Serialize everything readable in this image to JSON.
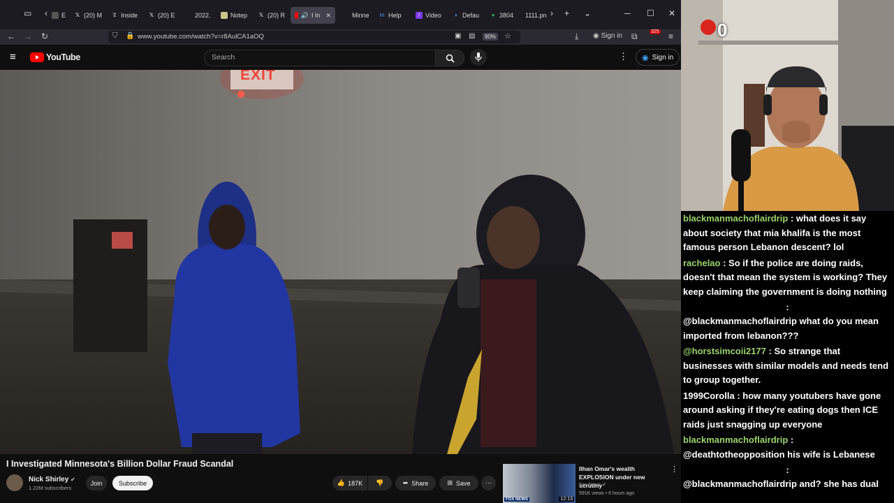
{
  "browser": {
    "tabs": [
      {
        "label": "E",
        "icon": "page-icon",
        "prefix": ")"
      },
      {
        "label": "(20) M",
        "icon": "x-icon"
      },
      {
        "label": "Inside",
        "icon": "nyt-icon"
      },
      {
        "label": "(20) E",
        "icon": "x-icon"
      },
      {
        "label": "2022.",
        "icon": "page-icon"
      },
      {
        "label": "Notep",
        "icon": "note-icon"
      },
      {
        "label": "(20) R",
        "icon": "x-icon"
      },
      {
        "label": "I In",
        "icon": "youtube-icon"
      },
      {
        "label": "Minne",
        "icon": "page-icon"
      },
      {
        "label": "Help",
        "icon": "m-icon"
      },
      {
        "label": "Video",
        "icon": "video-icon"
      },
      {
        "label": "Defau",
        "icon": "page-icon"
      },
      {
        "label": "3804",
        "icon": "map-icon"
      },
      {
        "label": "1111.pn",
        "icon": "page-icon"
      }
    ],
    "url": "www.youtube.com/watch?v=r8AulCA1aOQ",
    "zoom": "90%",
    "sign_in": "Sign in",
    "extensions_badge": "325"
  },
  "youtube": {
    "logo_text": "YouTube",
    "search_placeholder": "Search",
    "sign_in": "Sign in",
    "video_title": "I Investigated Minnesota's Billion Dollar Fraud Scandal",
    "channel_name": "Nick Shirley",
    "subscribers": "1.22M subscribers",
    "join_label": "Join",
    "subscribe_label": "Subscribe",
    "likes": "187K",
    "share_label": "Share",
    "save_label": "Save",
    "exit_sign": "EXIT",
    "recommended": {
      "title": "Ilhan Omar's wealth EXPLOSION under new scrutiny",
      "channel": "Fox News",
      "meta": "591K views • 6 hours ago",
      "duration": "12:13",
      "thumb_label": "FOX NEWS"
    }
  },
  "overlay": {
    "counter": "0"
  },
  "chat": [
    {
      "user": "blackmanmachoflairdrip",
      "text": ": what does it say about society that mia khalifa is the most famous person Lebanon descent? lol"
    },
    {
      "user": "rachelao",
      "text": ": So if the police are doing raids, doesn't that mean the system is working? They keep claiming the government is doing nothing"
    },
    {
      "sep": ":"
    },
    {
      "user": "",
      "text": "@blackmanmachoflairdrip what do you mean imported from lebanon???"
    },
    {
      "user": "@horstsimcoii2177",
      "text": ": So strange that businesses with similar models and needs tend to group together."
    },
    {
      "user": "1999Corolla",
      "text": ": how many youtubers have gone around asking if they're eating dogs then ICE raids just snagging up everyone",
      "white_user": true
    },
    {
      "user": "blackmanmachoflairdrip",
      "text": ":"
    },
    {
      "user": "",
      "text": "@deathtotheopposition his wife is Lebanese"
    },
    {
      "sep": ":"
    },
    {
      "user": "",
      "text": "@blackmanmachoflairdrip and? she has dual"
    }
  ]
}
